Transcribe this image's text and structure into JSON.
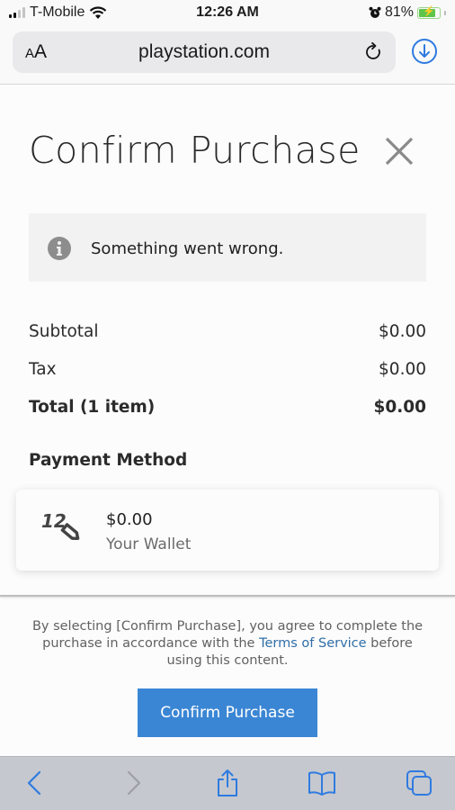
{
  "status_bar": {
    "carrier": "T-Mobile",
    "time": "12:26 AM",
    "battery_percent": "81%",
    "battery_level": 0.81,
    "signal_bars_filled": 2,
    "signal_bars_total": 4,
    "icons": [
      "signal-icon",
      "wifi-icon",
      "alarm-icon",
      "battery-charging-icon"
    ]
  },
  "browser": {
    "text_size_label_small": "A",
    "text_size_label_large": "A",
    "url": "playstation.com",
    "icons": [
      "reload-icon",
      "download-icon"
    ],
    "accent_color": "#2f7be0"
  },
  "dialog": {
    "title": "Confirm Purchase",
    "close_icon": "close-icon",
    "alert": {
      "icon": "info-icon",
      "message": "Something went wrong."
    },
    "summary": [
      {
        "label": "Subtotal",
        "value": "$0.00",
        "bold": false
      },
      {
        "label": "Tax",
        "value": "$0.00",
        "bold": false
      },
      {
        "label": "Total (1 item)",
        "value": "$0.00",
        "bold": true
      }
    ],
    "payment_method_heading": "Payment Method",
    "wallet": {
      "icon": "wallet-voucher-icon",
      "icon_text": "12",
      "amount": "$0.00",
      "label": "Your Wallet"
    },
    "agreement": {
      "before": "By selecting [Confirm Purchase], you agree to complete the purchase in accordance with the ",
      "link": "Terms of Service",
      "after": " before using this content."
    },
    "confirm_button": "Confirm Purchase",
    "button_color": "#3b86d4",
    "link_color": "#2f6ea8"
  },
  "toolbar": {
    "items": [
      {
        "name": "back-button",
        "icon": "chevron-left-icon",
        "enabled": true
      },
      {
        "name": "forward-button",
        "icon": "chevron-right-icon",
        "enabled": false
      },
      {
        "name": "share-button",
        "icon": "share-icon",
        "enabled": true
      },
      {
        "name": "bookmarks-button",
        "icon": "book-icon",
        "enabled": true
      },
      {
        "name": "tabs-button",
        "icon": "tabs-icon",
        "enabled": true
      }
    ]
  }
}
